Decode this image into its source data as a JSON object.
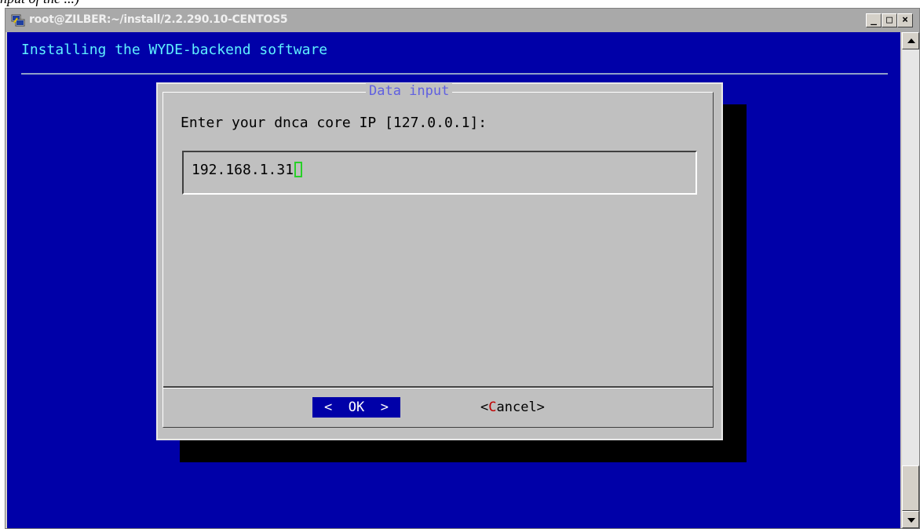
{
  "window": {
    "title": "root@ZILBER:~/install/2.2.290.10-CENTOS5",
    "icon": "putty-icon",
    "minimize_label": "_",
    "maximize_label": "□",
    "close_label": "×"
  },
  "terminal": {
    "header": "Installing the WYDE-backend software"
  },
  "dialog": {
    "title": "Data input",
    "prompt": "Enter your dnca core IP [127.0.0.1]:",
    "input_value": "192.168.1.31",
    "ok_label": "<  OK  >",
    "cancel_prefix": "<",
    "cancel_hotkey": "C",
    "cancel_rest": "ancel>"
  },
  "doc_fragment": "nput of the ...)",
  "colors": {
    "terminal_bg": "#0000a8",
    "header_text": "#5ff0ff",
    "dialog_bg": "#c0c0c0",
    "hotkey": "#c00000",
    "cursor": "#28d028"
  }
}
